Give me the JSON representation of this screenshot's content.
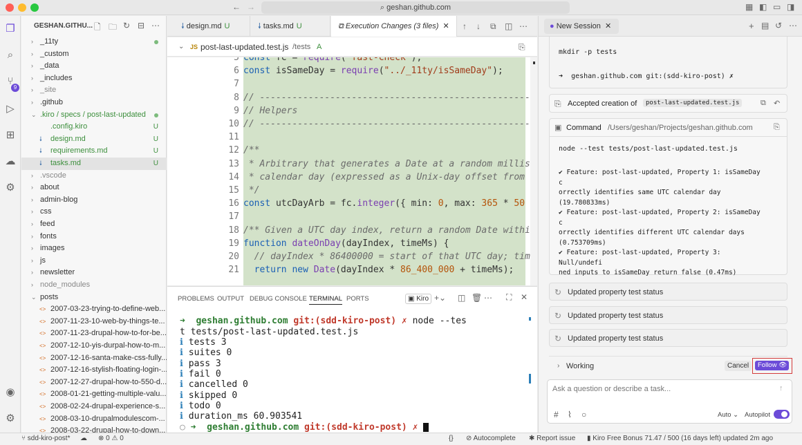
{
  "browser": {
    "url": "geshan.github.com"
  },
  "activity_bar": {
    "scm_badge": "9"
  },
  "explorer": {
    "title": "GESHAN.GITHU...",
    "items": [
      {
        "label": "_11ty",
        "type": "folder",
        "indent": 0,
        "dot": true
      },
      {
        "label": "_custom",
        "type": "folder",
        "indent": 0
      },
      {
        "label": "_data",
        "type": "folder",
        "indent": 0
      },
      {
        "label": "_includes",
        "type": "folder",
        "indent": 0
      },
      {
        "label": "_site",
        "type": "folder",
        "indent": 0,
        "dim": true
      },
      {
        "label": ".github",
        "type": "folder",
        "indent": 0
      },
      {
        "label": ".kiro / specs / post-last-updated",
        "type": "folder-open",
        "indent": 0,
        "dot": true,
        "git": true
      },
      {
        "label": ".config.kiro",
        "type": "file",
        "indent": 1,
        "status": "U",
        "git": true
      },
      {
        "label": "design.md",
        "type": "md",
        "indent": 1,
        "status": "U",
        "git": true
      },
      {
        "label": "requirements.md",
        "type": "md",
        "indent": 1,
        "status": "U",
        "git": true
      },
      {
        "label": "tasks.md",
        "type": "md",
        "indent": 1,
        "status": "U",
        "git": true,
        "selected": true
      },
      {
        "label": ".vscode",
        "type": "folder",
        "indent": 0,
        "dim": true
      },
      {
        "label": "about",
        "type": "folder",
        "indent": 0
      },
      {
        "label": "admin-blog",
        "type": "folder",
        "indent": 0
      },
      {
        "label": "css",
        "type": "folder",
        "indent": 0
      },
      {
        "label": "feed",
        "type": "folder",
        "indent": 0
      },
      {
        "label": "fonts",
        "type": "folder",
        "indent": 0
      },
      {
        "label": "images",
        "type": "folder",
        "indent": 0
      },
      {
        "label": "js",
        "type": "folder",
        "indent": 0
      },
      {
        "label": "newsletter",
        "type": "folder",
        "indent": 0
      },
      {
        "label": "node_modules",
        "type": "folder",
        "indent": 0,
        "dim": true
      },
      {
        "label": "posts",
        "type": "folder-open",
        "indent": 0
      },
      {
        "label": "2007-03-23-trying-to-define-web...",
        "type": "post",
        "indent": 1
      },
      {
        "label": "2007-11-23-10-web-by-things-te...",
        "type": "post",
        "indent": 1
      },
      {
        "label": "2007-11-23-drupal-how-to-for-be...",
        "type": "post",
        "indent": 1
      },
      {
        "label": "2007-12-10-yis-durpal-how-to-m...",
        "type": "post",
        "indent": 1
      },
      {
        "label": "2007-12-16-santa-make-css-fully...",
        "type": "post",
        "indent": 1
      },
      {
        "label": "2007-12-16-stylish-floating-login-...",
        "type": "post",
        "indent": 1
      },
      {
        "label": "2007-12-27-drupal-how-to-550-d...",
        "type": "post",
        "indent": 1
      },
      {
        "label": "2008-01-21-getting-multiple-valu...",
        "type": "post",
        "indent": 1
      },
      {
        "label": "2008-02-24-drupal-experience-s...",
        "type": "post",
        "indent": 1
      },
      {
        "label": "2008-03-10-drupalmodulescom-...",
        "type": "post",
        "indent": 1
      },
      {
        "label": "2008-03-22-drupal-how-to-down...",
        "type": "post",
        "indent": 1
      }
    ]
  },
  "tabs": [
    {
      "label": "design.md",
      "status": "U"
    },
    {
      "label": "tasks.md",
      "status": "U"
    },
    {
      "label": "Execution Changes (3 files)",
      "active": true
    }
  ],
  "breadcrumb": {
    "file": "post-last-updated.test.js",
    "path": "/tests",
    "status": "A",
    "lang": "JS"
  },
  "code": [
    {
      "n": "5",
      "html": "<span class=\"kw\">const</span> fc = <span class=\"fn\">require</span>(<span class=\"str\">\"fast-check\"</span>);"
    },
    {
      "n": "6",
      "html": "<span class=\"kw\">const</span> isSameDay = <span class=\"fn\">require</span>(<span class=\"str\">\"../_11ty/isSameDay\"</span>);"
    },
    {
      "n": "7",
      "html": ""
    },
    {
      "n": "8",
      "html": "<span class=\"cm\">// ------------------------------------------------------------</span>"
    },
    {
      "n": "9",
      "html": "<span class=\"cm\">// Helpers</span>"
    },
    {
      "n": "10",
      "html": "<span class=\"cm\">// ------------------------------------------------------------</span>"
    },
    {
      "n": "11",
      "html": ""
    },
    {
      "n": "12",
      "html": "<span class=\"cm\">/**</span>"
    },
    {
      "n": "13",
      "html": "<span class=\"cm\"> * Arbitrary that generates a Date at a random millis</span>"
    },
    {
      "n": "14",
      "html": "<span class=\"cm\"> * calendar day (expressed as a Unix-day offset from</span>"
    },
    {
      "n": "15",
      "html": "<span class=\"cm\"> */</span>"
    },
    {
      "n": "16",
      "html": "<span class=\"kw\">const</span> utcDayArb = fc.<span class=\"fn\">integer</span>({ min: <span class=\"num\">0</span>, max: <span class=\"num\">365</span> * <span class=\"num\">50</span>"
    },
    {
      "n": "17",
      "html": ""
    },
    {
      "n": "18",
      "html": "<span class=\"cm\">/** Given a UTC day index, return a random Date withi</span>"
    },
    {
      "n": "19",
      "html": "<span class=\"kw\">function</span> <span class=\"fn\">dateOnDay</span>(dayIndex, timeMs) {"
    },
    {
      "n": "20",
      "html": "  <span class=\"cm\">// dayIndex * 86400000 = start of that UTC day; tim</span>"
    },
    {
      "n": "21",
      "html": "  <span class=\"kw\">return new</span> <span class=\"fn\">Date</span>(dayIndex * <span class=\"num\">86_400_000</span> + timeMs);"
    }
  ],
  "panel": {
    "tabs": [
      "PROBLEMS",
      "OUTPUT",
      "DEBUG CONSOLE",
      "TERMINAL",
      "PORTS"
    ],
    "active_tab": "TERMINAL",
    "terminal_name": "Kiro"
  },
  "terminal": {
    "prompt_host": "geshan.github.com",
    "prompt_branch": "git:(sdd-kiro-post)",
    "command_a": "node --tes",
    "command_b": "t tests/post-last-updated.test.js",
    "results": [
      "tests 3",
      "suites 0",
      "pass 3",
      "fail 0",
      "cancelled 0",
      "skipped 0",
      "todo 0",
      "duration_ms 60.903541"
    ]
  },
  "chat": {
    "session_tab": "New Session",
    "cmd_top": "mkdir -p tests",
    "cmd_top_prompt": "geshan.github.com git:(sdd-kiro-post) ✗",
    "accepted_label": "Accepted creation of",
    "accepted_file": "post-last-updated.test.js",
    "command_label": "Command",
    "command_path": "/Users/geshan/Projects/geshan.github.com",
    "command": "node --test tests/post-last-updated.test.js",
    "output_lines": [
      "✔ Feature: post-last-updated, Property 1: isSameDay",
      "c",
      "orrectly identifies same UTC calendar day",
      "(19.780833ms)",
      "✔ Feature: post-last-updated, Property 2: isSameDay",
      "c",
      "orrectly identifies different UTC calendar days",
      "(0.753709ms)",
      "✔ Feature: post-last-updated, Property 3:",
      "Null/undefi",
      "ned inputs to isSameDay return false (0.47ms)"
    ],
    "status_rows": [
      "Updated property test status",
      "Updated property test status",
      "Updated property test status"
    ],
    "working_label": "Working",
    "cancel_label": "Cancel",
    "follow_label": "Follow",
    "input_placeholder": "Ask a question or describe a task...",
    "auto_label": "Auto",
    "autopilot_label": "Autopilot"
  },
  "statusbar": {
    "branch": "sdd-kiro-post*",
    "errors": "0",
    "warnings": "0",
    "braces": "{}",
    "autocomplete": "Autocomplete",
    "report": "Report issue",
    "bonus": "Kiro Free Bonus 71.47 / 500 (16 days left) updated 2m ago"
  }
}
